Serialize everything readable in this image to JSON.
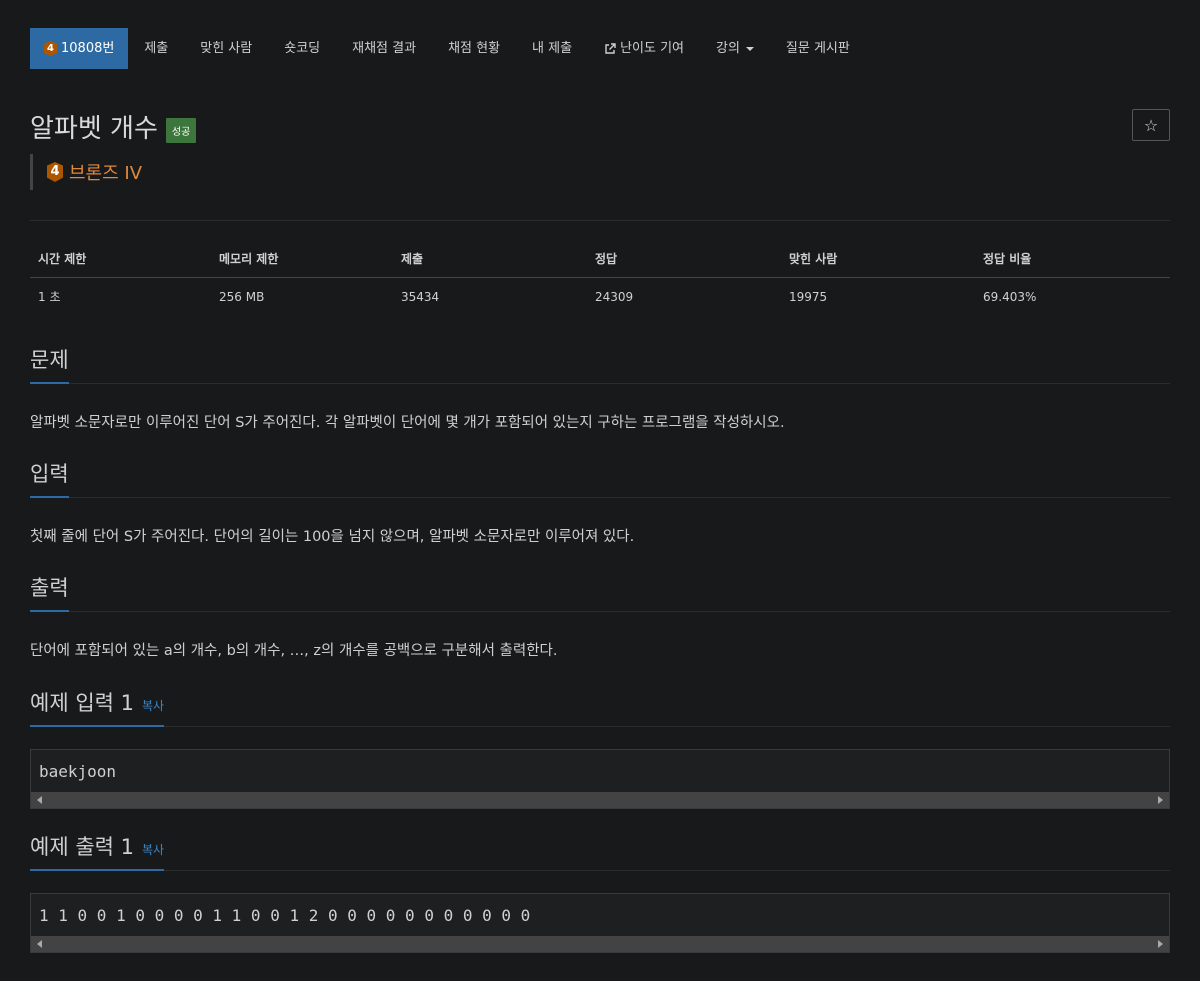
{
  "nav": {
    "problem_tier": "4",
    "problem_id": "10808번",
    "items": [
      "제출",
      "맞힌 사람",
      "숏코딩",
      "재채점 결과",
      "채점 현황",
      "내 제출",
      "난이도 기여",
      "강의"
    ],
    "last": "질문 게시판"
  },
  "problem": {
    "title": "알파벳 개수",
    "status_badge": "성공",
    "star": "☆",
    "tier_number": "4",
    "tier_name": "브론즈 IV"
  },
  "stats": {
    "headers": [
      "시간 제한",
      "메모리 제한",
      "제출",
      "정답",
      "맞힌 사람",
      "정답 비율"
    ],
    "values": [
      "1 초",
      "256 MB",
      "35434",
      "24309",
      "19975",
      "69.403%"
    ]
  },
  "sections": {
    "problem": {
      "title": "문제",
      "text": "알파벳 소문자로만 이루어진 단어 S가 주어진다. 각 알파벳이 단어에 몇 개가 포함되어 있는지 구하는 프로그램을 작성하시오."
    },
    "input": {
      "title": "입력",
      "text": "첫째 줄에 단어 S가 주어진다. 단어의 길이는 100을 넘지 않으며, 알파벳 소문자로만 이루어져 있다."
    },
    "output": {
      "title": "출력",
      "text": "단어에 포함되어 있는 a의 개수, b의 개수, …, z의 개수를 공백으로 구분해서 출력한다."
    },
    "sample_input": {
      "title": "예제 입력 1",
      "copy": "복사",
      "text": "baekjoon"
    },
    "sample_output": {
      "title": "예제 출력 1",
      "copy": "복사",
      "text": "1 1 0 0 1 0 0 0 0 1 1 0 0 1 2 0 0 0 0 0 0 0 0 0 0 0"
    }
  },
  "colors": {
    "nav_active": "#2d6aa3",
    "success": "#3c763d",
    "bronze": "#ad5600",
    "tier_text": "#e0893a",
    "link": "#3a87cc"
  }
}
